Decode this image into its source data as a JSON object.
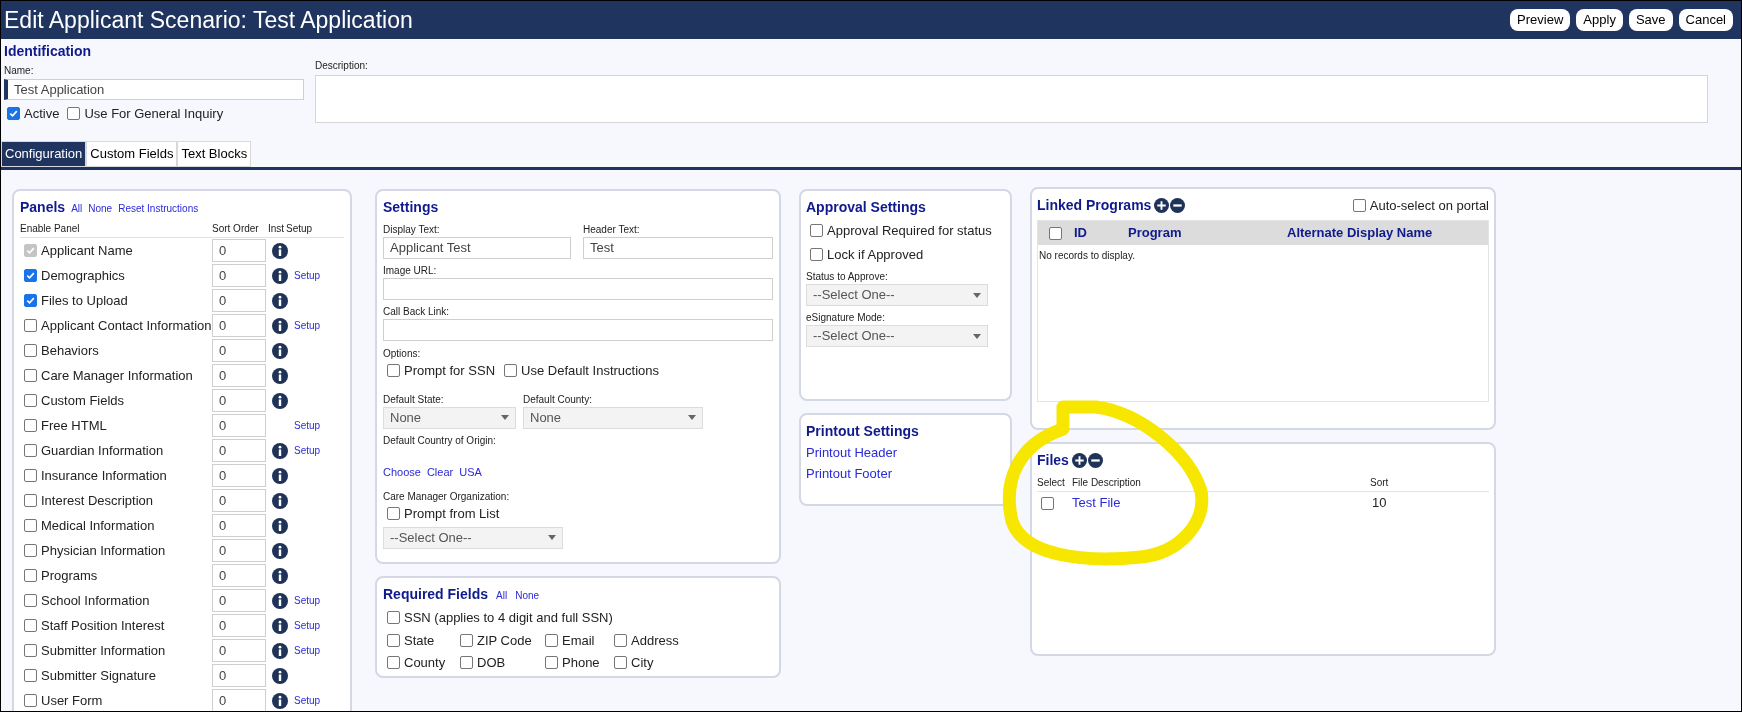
{
  "window": {
    "title": "Edit Applicant Scenario: Test Application"
  },
  "header_buttons": [
    "Preview",
    "Apply",
    "Save",
    "Cancel"
  ],
  "identification": {
    "heading": "Identification",
    "name_label": "Name:",
    "name_value": "Test Application",
    "description_label": "Description:",
    "options": [
      {
        "label": "Active",
        "checked": true
      },
      {
        "label": "Use For General Inquiry",
        "checked": false
      }
    ]
  },
  "tabs": [
    {
      "label": "Configuration",
      "selected": true
    },
    {
      "label": "Custom Fields",
      "selected": false
    },
    {
      "label": "Text Blocks",
      "selected": false
    }
  ],
  "panels": {
    "heading": "Panels",
    "links": [
      "All",
      "None",
      "Reset Instructions"
    ],
    "columns": [
      "Enable Panel",
      "Sort Order",
      "Inst",
      "Setup"
    ],
    "rows": [
      {
        "label": "Applicant Name",
        "checked": true,
        "disabled": true,
        "sort": "0",
        "info": true
      },
      {
        "label": "Demographics",
        "checked": true,
        "disabled": false,
        "sort": "0",
        "info": true,
        "setup": "Setup"
      },
      {
        "label": "Files to Upload",
        "checked": true,
        "disabled": false,
        "sort": "0",
        "info": true
      },
      {
        "label": "Applicant Contact Information",
        "checked": false,
        "disabled": false,
        "sort": "0",
        "info": true,
        "setup": "Setup"
      },
      {
        "label": "Behaviors",
        "checked": false,
        "disabled": false,
        "sort": "0",
        "info": true
      },
      {
        "label": "Care Manager Information",
        "checked": false,
        "disabled": false,
        "sort": "0",
        "info": true
      },
      {
        "label": "Custom Fields",
        "checked": false,
        "disabled": false,
        "sort": "0",
        "info": true
      },
      {
        "label": "Free HTML",
        "checked": false,
        "disabled": false,
        "sort": "0",
        "info": false,
        "setup": "Setup"
      },
      {
        "label": "Guardian Information",
        "checked": false,
        "disabled": false,
        "sort": "0",
        "info": true,
        "setup": "Setup"
      },
      {
        "label": "Insurance Information",
        "checked": false,
        "disabled": false,
        "sort": "0",
        "info": true
      },
      {
        "label": "Interest Description",
        "checked": false,
        "disabled": false,
        "sort": "0",
        "info": true
      },
      {
        "label": "Medical Information",
        "checked": false,
        "disabled": false,
        "sort": "0",
        "info": true
      },
      {
        "label": "Physician Information",
        "checked": false,
        "disabled": false,
        "sort": "0",
        "info": true
      },
      {
        "label": "Programs",
        "checked": false,
        "disabled": false,
        "sort": "0",
        "info": true
      },
      {
        "label": "School Information",
        "checked": false,
        "disabled": false,
        "sort": "0",
        "info": true,
        "setup": "Setup"
      },
      {
        "label": "Staff Position Interest",
        "checked": false,
        "disabled": false,
        "sort": "0",
        "info": true,
        "setup": "Setup"
      },
      {
        "label": "Submitter Information",
        "checked": false,
        "disabled": false,
        "sort": "0",
        "info": true,
        "setup": "Setup"
      },
      {
        "label": "Submitter Signature",
        "checked": false,
        "disabled": false,
        "sort": "0",
        "info": true
      },
      {
        "label": "User Form",
        "checked": false,
        "disabled": false,
        "sort": "0",
        "info": true,
        "setup": "Setup"
      }
    ]
  },
  "settings": {
    "heading": "Settings",
    "display_text_label": "Display Text:",
    "display_text_value": "Applicant Test",
    "header_text_label": "Header Text:",
    "header_text_value": "Test",
    "image_url_label": "Image URL:",
    "call_back_label": "Call Back Link:",
    "options_label": "Options:",
    "options": [
      {
        "label": "Prompt for SSN",
        "checked": false
      },
      {
        "label": "Use Default Instructions",
        "checked": false
      }
    ],
    "default_state_label": "Default State:",
    "default_state_value": "None",
    "default_county_label": "Default County:",
    "default_county_value": "None",
    "country_label": "Default Country of Origin:",
    "country_links": [
      "Choose",
      "Clear",
      "USA"
    ],
    "care_manager_label": "Care Manager Organization:",
    "prompt_from_list": {
      "label": "Prompt from List",
      "checked": false
    },
    "care_manager_value": "--Select One--"
  },
  "required_fields": {
    "heading": "Required Fields",
    "links": [
      "All",
      "None"
    ],
    "ssn": {
      "label": "SSN (applies to 4 digit and full SSN)",
      "checked": false
    },
    "items": [
      {
        "label": "State",
        "checked": false
      },
      {
        "label": "ZIP Code",
        "checked": false
      },
      {
        "label": "Email",
        "checked": false
      },
      {
        "label": "Address",
        "checked": false
      },
      {
        "label": "County",
        "checked": false
      },
      {
        "label": "DOB",
        "checked": false
      },
      {
        "label": "Phone",
        "checked": false
      },
      {
        "label": "City",
        "checked": false
      }
    ]
  },
  "approval_settings": {
    "heading": "Approval Settings",
    "options": [
      {
        "label": "Approval Required for status",
        "checked": false
      },
      {
        "label": "Lock if Approved",
        "checked": false
      }
    ],
    "status_label": "Status to Approve:",
    "status_value": "--Select One--",
    "esignature_label": "eSignature Mode:",
    "esignature_value": "--Select One--"
  },
  "printout_settings": {
    "heading": "Printout Settings",
    "links": [
      "Printout Header",
      "Printout Footer"
    ]
  },
  "linked_programs": {
    "heading": "Linked Programs",
    "auto_select": {
      "label": "Auto-select on portal",
      "checked": false
    },
    "select_all_checked": false,
    "columns": [
      "ID",
      "Program",
      "Alternate Display Name"
    ],
    "empty_message": "No records to display."
  },
  "files": {
    "heading": "Files",
    "columns": [
      "Select",
      "File Description",
      "Sort"
    ],
    "rows": [
      {
        "checked": false,
        "description": "Test File",
        "sort": "10"
      }
    ]
  }
}
